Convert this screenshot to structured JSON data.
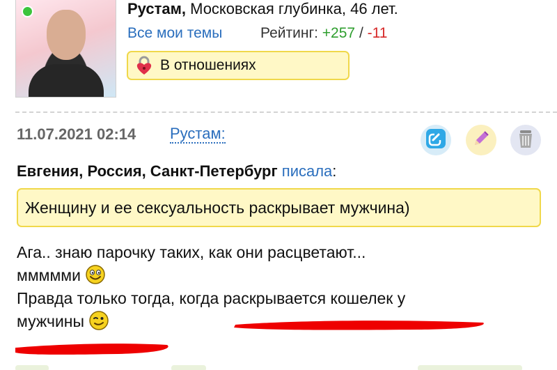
{
  "profile": {
    "name": "Рустам,",
    "location_age": "Московская глубинка, 46 лет.",
    "themes_link": "Все мои темы",
    "rating_label": "Рейтинг:",
    "rating_positive": "+257",
    "rating_separator": "/",
    "rating_negative": "-11",
    "status": "В отношениях",
    "online": true
  },
  "post": {
    "datetime": "11.07.2021 02:14",
    "author": "Рустам:",
    "actions": {
      "link_icon": "link-icon",
      "edit_icon": "pencil-icon",
      "delete_icon": "trash-icon"
    },
    "quote_author": "Евгения, Россия, Санкт-Петербург",
    "quote_wrote": "писала",
    "quote_colon": ":",
    "quote_text": "Женщину и ее сексуальность раскрывает мужчина)",
    "message_line1": "Ага.. знаю парочку таких, как они расцветают...",
    "message_line2": "ммммми",
    "message_line3": "Правда только тогда, когда раскрывается кошелек у",
    "message_line4": "мужчины"
  },
  "colors": {
    "link": "#2a6ebd",
    "positive": "#2e9e2e",
    "negative": "#d62828",
    "quote_bg": "#fff8c6",
    "quote_border": "#f0d84a",
    "scribble": "#ee0000"
  }
}
